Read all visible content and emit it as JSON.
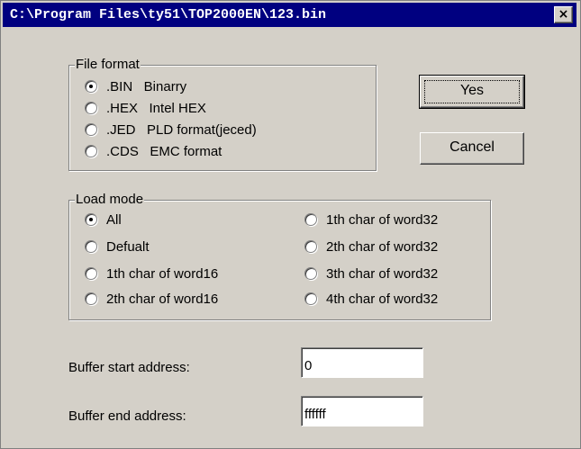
{
  "window": {
    "title": "C:\\Program Files\\ty51\\TOP2000EN\\123.bin",
    "close_label": "×"
  },
  "file_format": {
    "legend": "File format",
    "options": [
      {
        "label": ".BIN   Binarry",
        "checked": true
      },
      {
        "label": ".HEX   Intel HEX",
        "checked": false
      },
      {
        "label": ".JED   PLD format(jeced)",
        "checked": false
      },
      {
        "label": ".CDS   EMC format",
        "checked": false
      }
    ]
  },
  "load_mode": {
    "legend": "Load mode",
    "left_options": [
      {
        "label": "All",
        "checked": true
      },
      {
        "label": "Defualt",
        "checked": false
      },
      {
        "label": "1th char of word16",
        "checked": false
      },
      {
        "label": "2th char of word16",
        "checked": false
      }
    ],
    "right_options": [
      {
        "label": "1th char of word32",
        "checked": false
      },
      {
        "label": "2th char of word32",
        "checked": false
      },
      {
        "label": "3th char of word32",
        "checked": false
      },
      {
        "label": "4th char of word32",
        "checked": false
      }
    ]
  },
  "buttons": {
    "yes": "Yes",
    "cancel": "Cancel"
  },
  "buffer": {
    "start_label": "Buffer start address:",
    "start_value": "0",
    "end_label": "Buffer end address:",
    "end_value": "ffffff"
  }
}
